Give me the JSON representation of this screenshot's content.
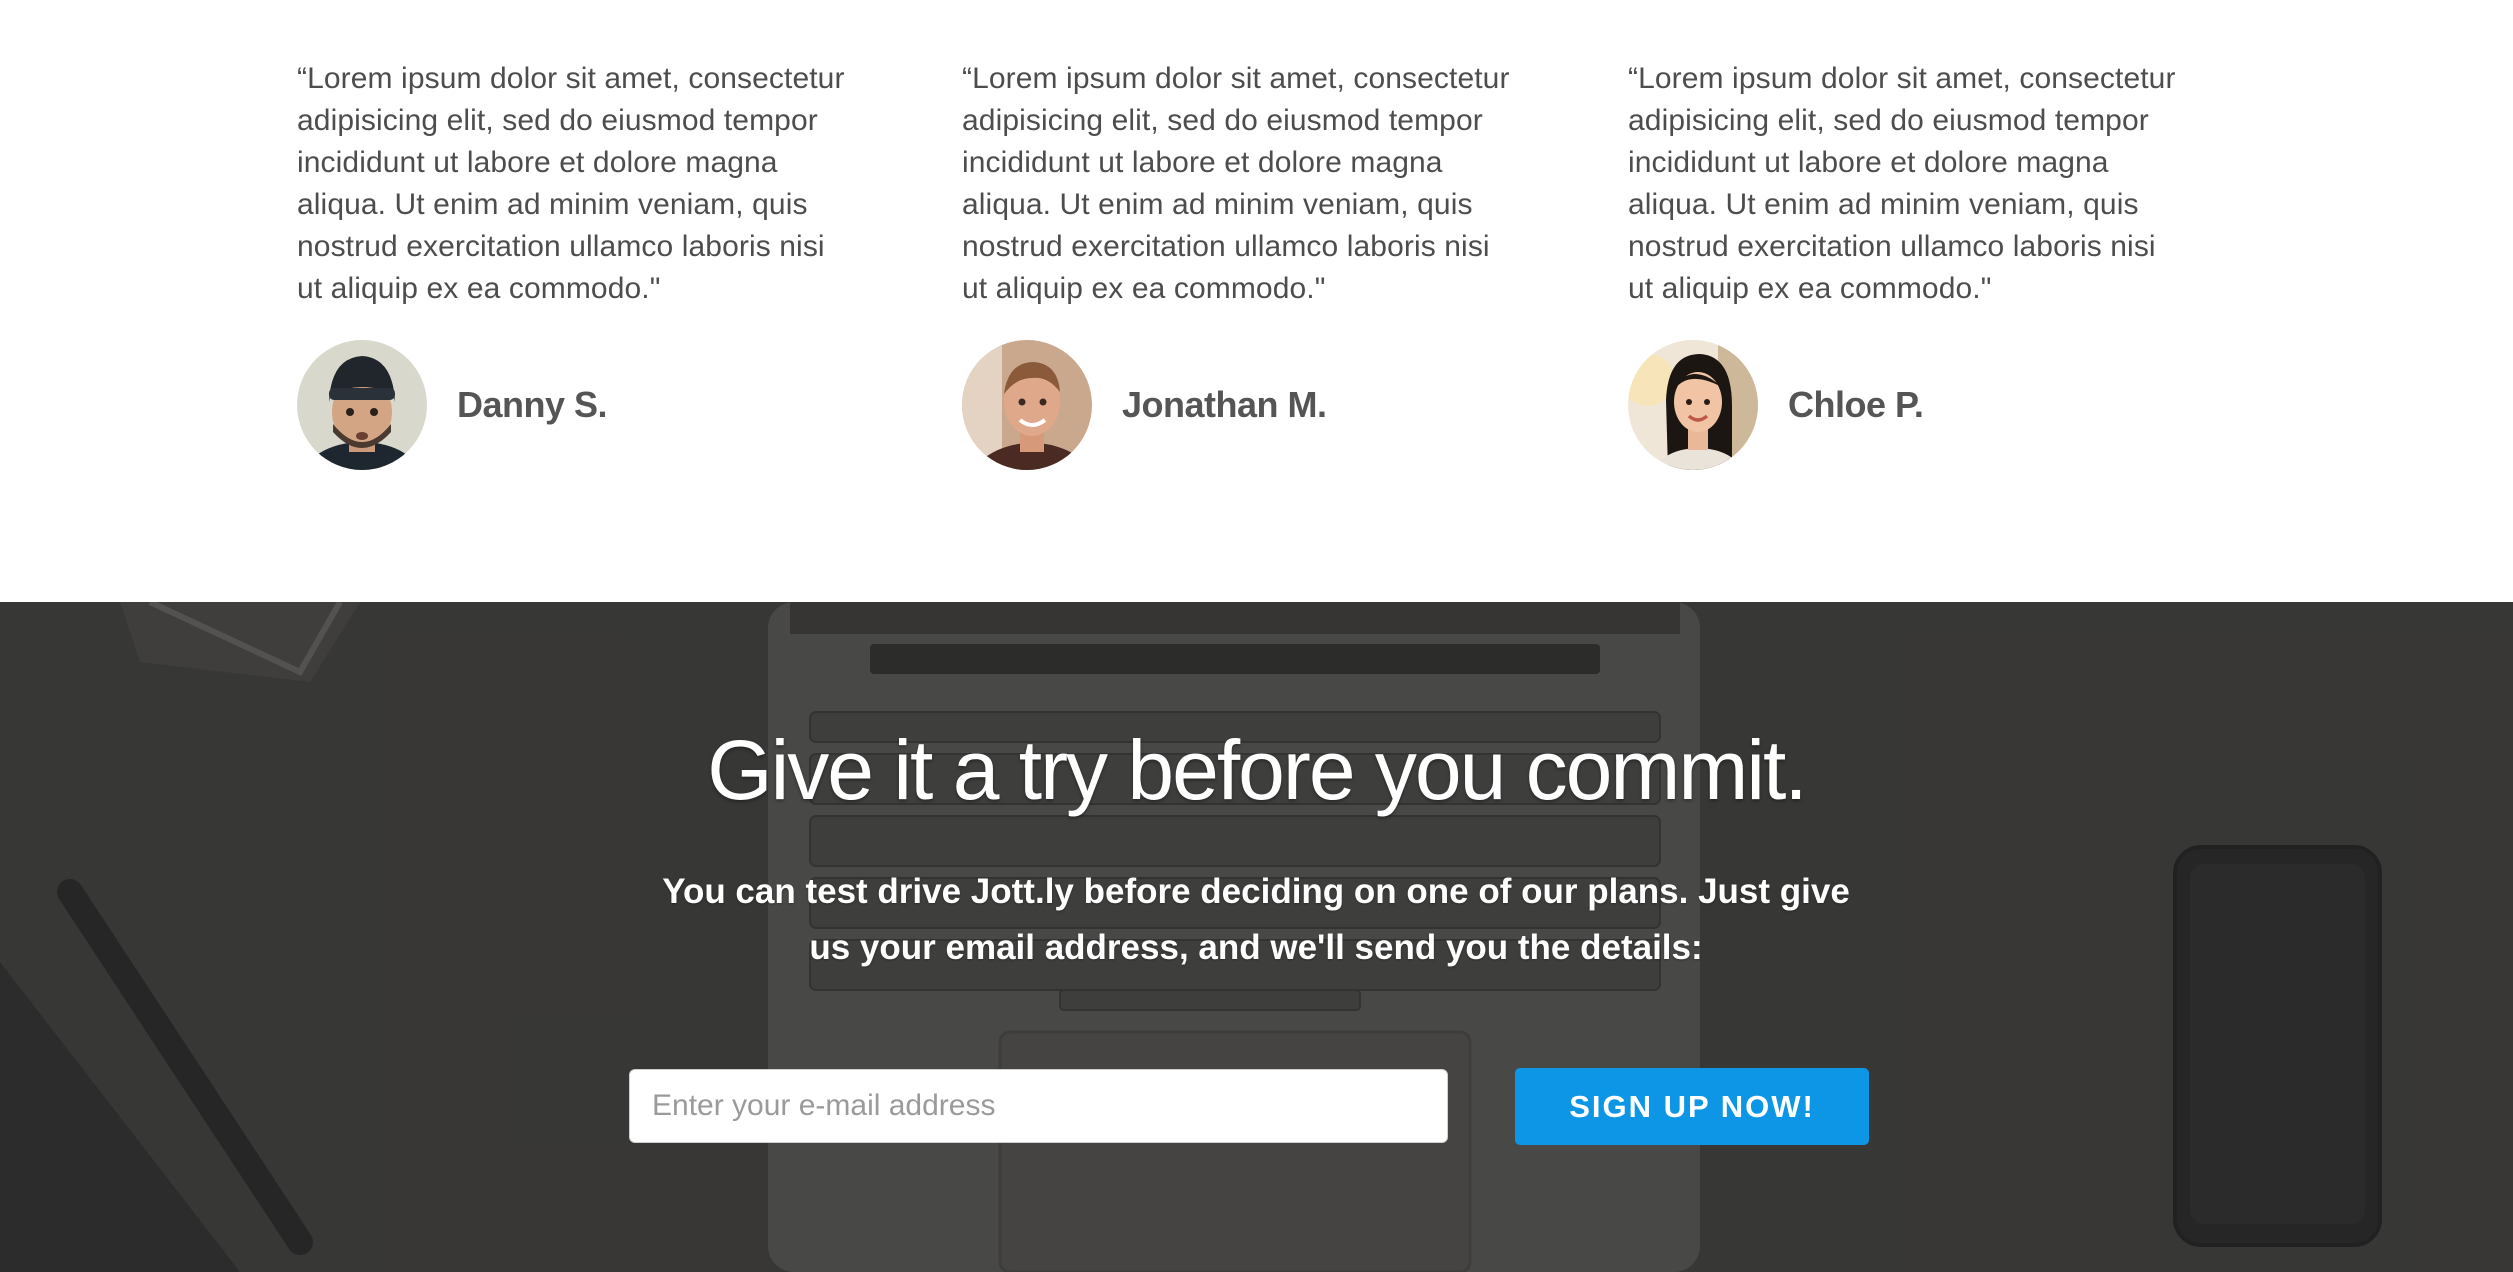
{
  "testimonials": [
    {
      "quote": "“Lorem ipsum dolor sit amet, consectetur adipisicing elit, sed do eiusmod tempor incididunt ut labore et dolore magna aliqua. Ut enim ad minim veniam, quis nostrud exercitation ullamco laboris nisi ut aliquip ex ea commodo.\"",
      "name": "Danny S."
    },
    {
      "quote": "“Lorem ipsum dolor sit amet, consectetur adipisicing elit, sed do eiusmod tempor incididunt ut labore et dolore magna aliqua. Ut enim ad minim veniam, quis nostrud exercitation ullamco laboris nisi ut aliquip ex ea commodo.\"",
      "name": "Jonathan M."
    },
    {
      "quote": "“Lorem ipsum dolor sit amet, consectetur adipisicing elit, sed do eiusmod tempor incididunt ut labore et dolore magna aliqua. Ut enim ad minim veniam, quis nostrud exercitation ullamco laboris nisi ut aliquip ex ea commodo.\"",
      "name": "Chloe P."
    }
  ],
  "cta": {
    "title": "Give it a try before you commit.",
    "subtitle": "You can test drive Jott.ly before deciding on one of our plans. Just give us your email address, and we'll send you the details:",
    "email_placeholder": "Enter your e-mail address",
    "button_label": "SIGN UP NOW!"
  },
  "colors": {
    "button": "#0d96e6",
    "testimonial_text": "#4d4d4d",
    "author_name": "#555555",
    "cta_background": "#3f3e3c"
  },
  "icons": {
    "avatars": [
      "danny-avatar",
      "jonathan-avatar",
      "chloe-avatar"
    ]
  }
}
